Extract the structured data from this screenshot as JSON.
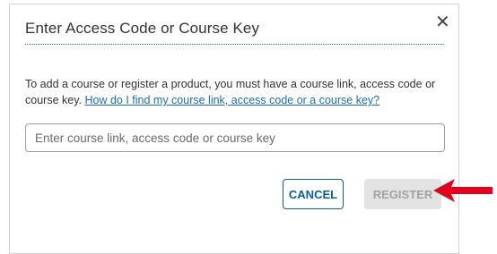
{
  "dialog": {
    "title": "Enter Access Code or Course Key",
    "close_glyph": "✕",
    "description": "To add a course or register a product, you must have a course link, access code or course key.",
    "help_link": "How do I find my course link, access code or a course key?",
    "input": {
      "value": "",
      "placeholder": "Enter course link, access code or course key"
    },
    "cancel_label": "CANCEL",
    "register_label": "REGISTER",
    "register_disabled": true
  },
  "icons": {
    "close": "close-icon",
    "annotation": "red-arrow-icon"
  },
  "colors": {
    "link": "#1a6fb8",
    "cancel_border": "#0b5f97",
    "register_disabled_bg": "#e3e3e3",
    "arrow": "#e3001b"
  }
}
